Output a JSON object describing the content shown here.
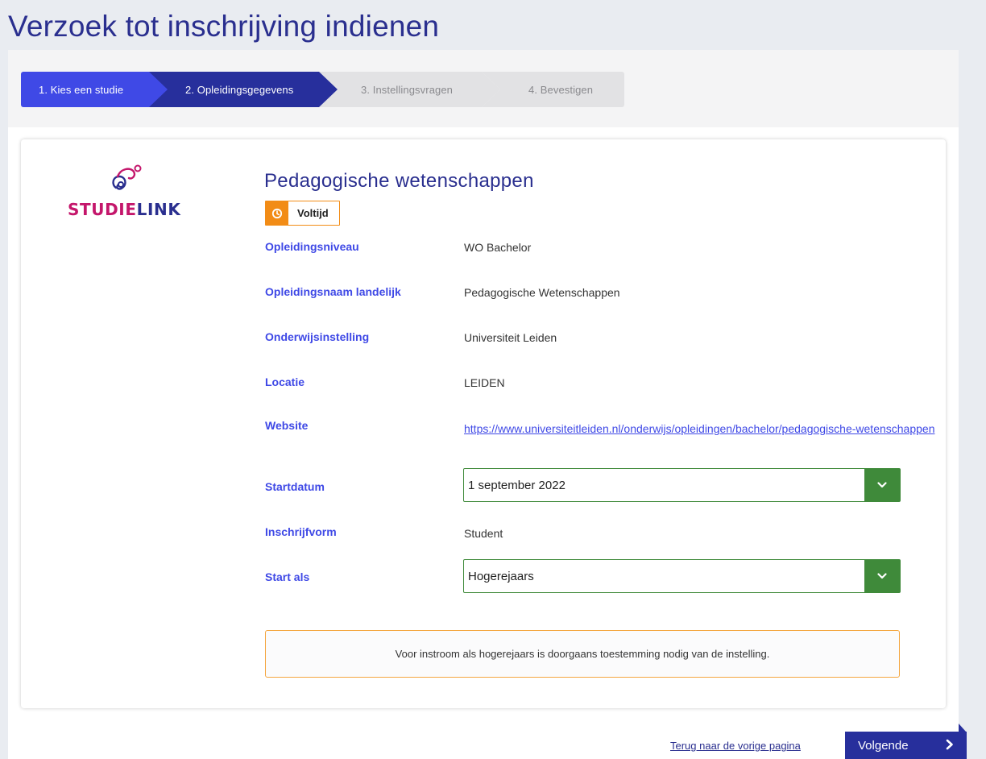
{
  "page": {
    "title": "Verzoek tot inschrijving indienen"
  },
  "stepper": {
    "steps": [
      {
        "label": "1. Kies een studie",
        "state": "done"
      },
      {
        "label": "2. Opleidingsgegevens",
        "state": "active"
      },
      {
        "label": "3. Instellingsvragen",
        "state": "pending"
      },
      {
        "label": "4. Bevestigen",
        "state": "pending"
      }
    ]
  },
  "logo": {
    "text_part1": "STUDIE",
    "text_part2": "LINK",
    "icon": "studielink-logo-icon"
  },
  "program": {
    "title": "Pedagogische wetenschappen",
    "badge": {
      "label": "Voltijd",
      "icon": "clock-icon"
    }
  },
  "details": {
    "level": {
      "label": "Opleidingsniveau",
      "value": "WO Bachelor"
    },
    "national_name": {
      "label": "Opleidingsnaam landelijk",
      "value": "Pedagogische Wetenschappen"
    },
    "institution": {
      "label": "Onderwijsinstelling",
      "value": "Universiteit Leiden"
    },
    "location": {
      "label": "Locatie",
      "value": "LEIDEN"
    },
    "website": {
      "label": "Website",
      "value": "https://www.universiteitleiden.nl/onderwijs/opleidingen/bachelor/pedagogische-wetenschappen"
    },
    "start_date": {
      "label": "Startdatum",
      "value": "1 september 2022"
    },
    "enrollment_form": {
      "label": "Inschrijfvorm",
      "value": "Student"
    },
    "start_as": {
      "label": "Start als",
      "value": "Hogerejaars"
    }
  },
  "notice": {
    "text": "Voor instroom als hogerejaars is doorgaans toestemming nodig van de instelling."
  },
  "footer": {
    "back_label": "Terug naar de vorige pagina",
    "next_label": "Volgende"
  },
  "colors": {
    "primary": "#3f49e6",
    "primary_dark": "#272f9c",
    "accent_orange": "#f28c16",
    "select_green": "#3f8a3a",
    "brand_magenta": "#c4166b"
  }
}
